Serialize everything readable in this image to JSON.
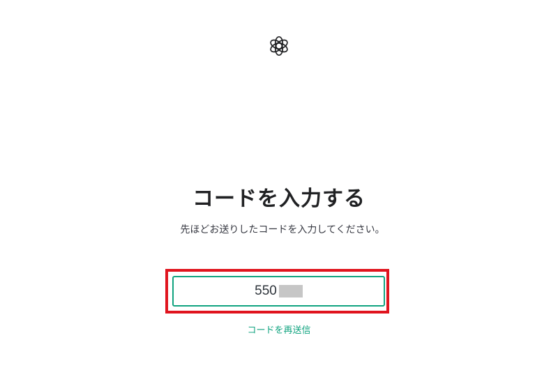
{
  "brand": {
    "logo_icon": "openai-logo-icon"
  },
  "page": {
    "title": "コードを入力する",
    "subtitle": "先ほどお送りしたコードを入力してください。"
  },
  "code_field": {
    "value": "550",
    "value_partially_redacted": true,
    "border_color": "#10a37f"
  },
  "highlight": {
    "color": "#e0141e"
  },
  "resend": {
    "label": "コードを再送信",
    "color": "#10a37f"
  }
}
